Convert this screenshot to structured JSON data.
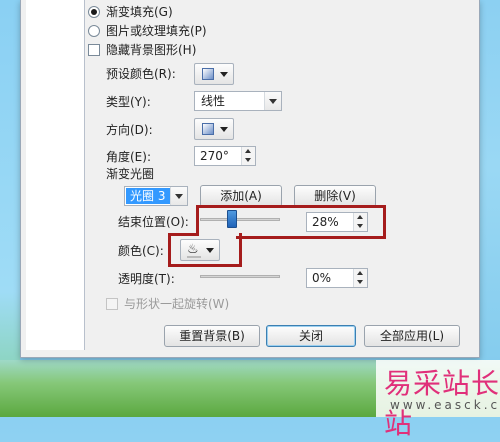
{
  "fill_options": {
    "gradient_fill_label": "渐变填充(G)",
    "picture_texture_fill_label": "图片或纹理填充(P)",
    "hide_background_label": "隐藏背景图形(H)"
  },
  "gradient": {
    "preset_colors_label": "预设颜色(R):",
    "type_label": "类型(Y):",
    "type_value": "线性",
    "direction_label": "方向(D):",
    "angle_label": "角度(E):",
    "angle_value": "270°",
    "stops_section_label": "渐变光圈",
    "stop_selector_value": "光圈 3",
    "add_button_label": "添加(A)",
    "delete_button_label": "删除(V)",
    "end_position_label": "结束位置(O):",
    "end_position_value": "28%",
    "end_position_fraction": 0.28,
    "color_label": "颜色(C):",
    "transparency_label": "透明度(T):",
    "transparency_value": "0%",
    "transparency_fraction": 0.0,
    "rotate_with_shape_label": "与形状一起旋转(W)"
  },
  "footer": {
    "reset_background_label": "重置背景(B)",
    "close_label": "关闭",
    "apply_all_label": "全部应用(L)"
  },
  "watermark": {
    "site_name": "易采站长站",
    "url": "www.easck.com"
  },
  "colors": {
    "highlight_box": "#a51c1c",
    "stop_selector_bg": "#3399ff"
  }
}
